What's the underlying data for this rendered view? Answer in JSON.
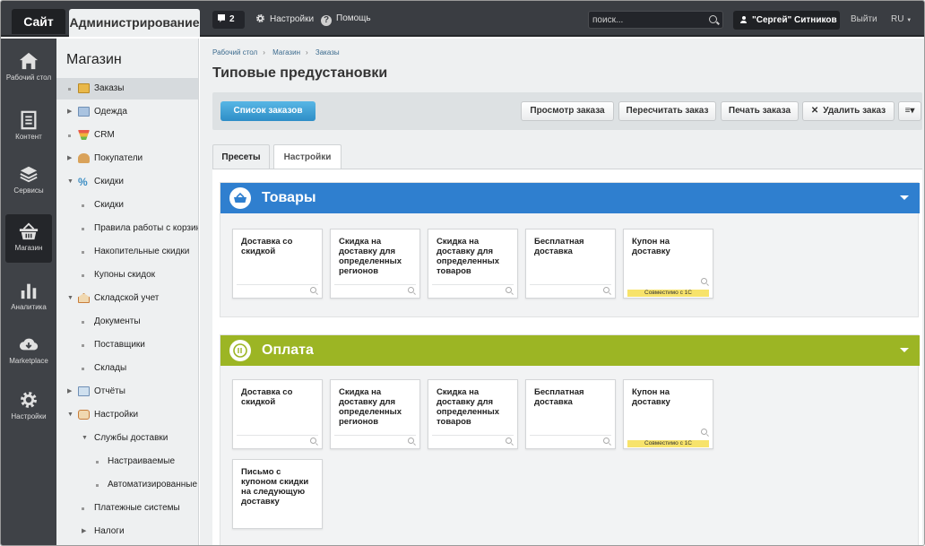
{
  "topbar": {
    "site_tab": "Сайт",
    "admin_tab": "Администрирование",
    "notifications_count": "2",
    "settings_label": "Настройки",
    "help_label": "Помощь",
    "search_placeholder": "поиск...",
    "user_name": "\"Сергей\" Ситников",
    "logout_label": "Выйти",
    "lang_label": "RU"
  },
  "iconbar": [
    {
      "label": "Рабочий стол",
      "icon": "home-icon"
    },
    {
      "label": "Контент",
      "icon": "document-icon"
    },
    {
      "label": "Сервисы",
      "icon": "layers-icon"
    },
    {
      "label": "Магазин",
      "icon": "basket-icon"
    },
    {
      "label": "Аналитика",
      "icon": "bar-chart-icon"
    },
    {
      "label": "Marketplace",
      "icon": "cloud-download-icon"
    },
    {
      "label": "Настройки",
      "icon": "gear-icon"
    }
  ],
  "sidebar": {
    "title": "Магазин",
    "items": [
      {
        "label": "Заказы"
      },
      {
        "label": "Одежда"
      },
      {
        "label": "CRM"
      },
      {
        "label": "Покупатели"
      },
      {
        "label": "Скидки"
      },
      {
        "label": "Скидки"
      },
      {
        "label": "Правила работы с корзиной"
      },
      {
        "label": "Накопительные скидки"
      },
      {
        "label": "Купоны скидок"
      },
      {
        "label": "Складской учет"
      },
      {
        "label": "Документы"
      },
      {
        "label": "Поставщики"
      },
      {
        "label": "Склады"
      },
      {
        "label": "Отчёты"
      },
      {
        "label": "Настройки"
      },
      {
        "label": "Службы доставки"
      },
      {
        "label": "Настраиваемые"
      },
      {
        "label": "Автоматизированные"
      },
      {
        "label": "Платежные системы"
      },
      {
        "label": "Налоги"
      }
    ]
  },
  "breadcrumbs": [
    "Рабочий стол",
    "Магазин",
    "Заказы"
  ],
  "page_title": "Типовые предустановки",
  "toolbar": {
    "list_button": "Список заказов",
    "view_order": "Просмотр заказа",
    "recalc_order": "Пересчитать заказ",
    "print_order": "Печать заказа",
    "delete_order": "Удалить заказ"
  },
  "tabs": {
    "presets": "Пресеты",
    "settings": "Настройки"
  },
  "sections": [
    {
      "title": "Товары",
      "color": "#2f7fcf",
      "cards": [
        {
          "title": "Доставка со скидкой"
        },
        {
          "title": "Скидка на доставку для определенных регионов"
        },
        {
          "title": "Скидка на доставку для определенных товаров"
        },
        {
          "title": "Бесплатная доставка"
        },
        {
          "title": "Купон на доставку",
          "badge": "Совместимо с 1С"
        }
      ]
    },
    {
      "title": "Оплата",
      "color": "#9cb524",
      "cards": [
        {
          "title": "Доставка со скидкой"
        },
        {
          "title": "Скидка на доставку для определенных регионов"
        },
        {
          "title": "Скидка на доставку для определенных товаров"
        },
        {
          "title": "Бесплатная доставка"
        },
        {
          "title": "Купон на доставку",
          "badge": "Совместимо с 1С"
        },
        {
          "title": "Письмо с купоном скидки на следующую доставку"
        }
      ]
    }
  ]
}
